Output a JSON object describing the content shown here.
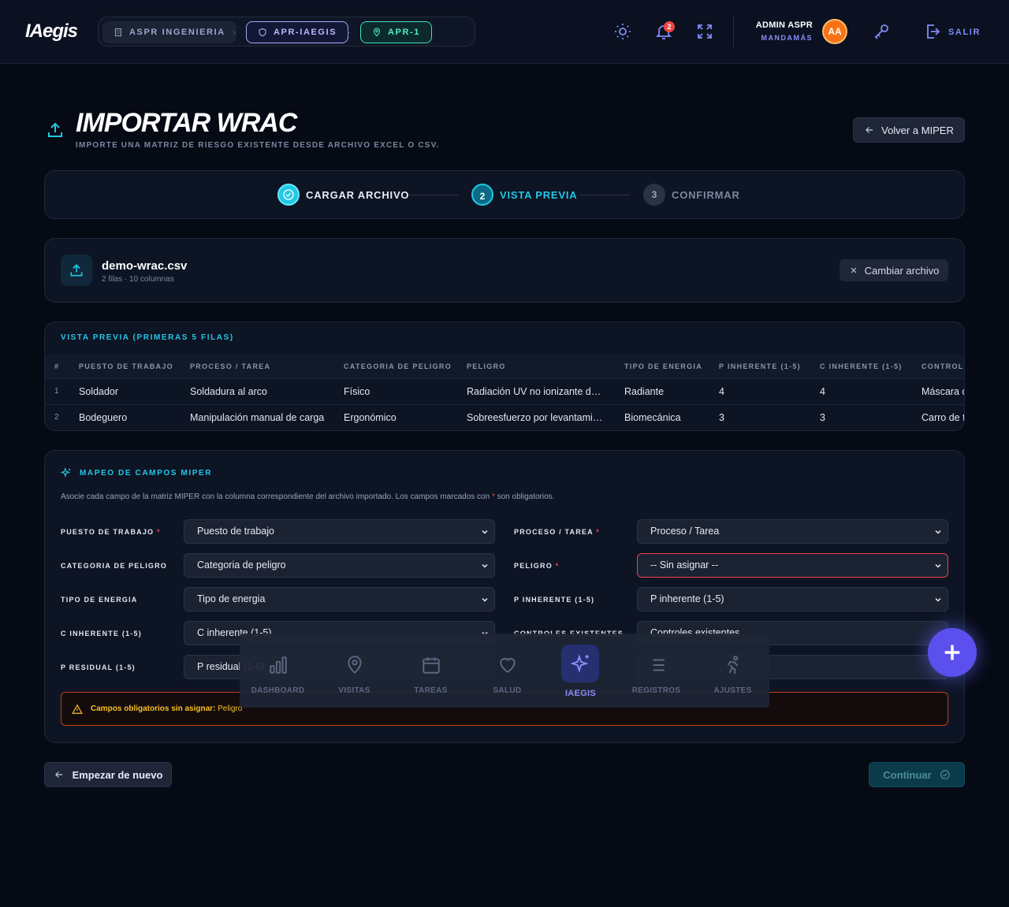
{
  "header": {
    "logo": "IAegis",
    "breadcrumbs": [
      "ASPR INGENIERIA",
      "APR-IAEGIS",
      "APR-1"
    ],
    "notification_count": "2",
    "user_name": "ADMIN ASPR",
    "user_role": "MANDAMÁS",
    "avatar_initials": "AA",
    "logout_label": "SALIR"
  },
  "page": {
    "title": "IMPORTAR WRAC",
    "subtitle": "IMPORTE UNA MATRIZ DE RIESGO EXISTENTE DESDE ARCHIVO EXCEL O CSV.",
    "back_label": "Volver a MIPER"
  },
  "stepper": {
    "steps": [
      {
        "number": "✓",
        "label": "CARGAR ARCHIVO",
        "state": "done"
      },
      {
        "number": "2",
        "label": "VISTA PREVIA",
        "state": "active"
      },
      {
        "number": "3",
        "label": "CONFIRMAR",
        "state": "pending"
      }
    ]
  },
  "file": {
    "name": "demo-wrac.csv",
    "meta": "2 filas · 10 columnas",
    "change_label": "Cambiar archivo"
  },
  "preview": {
    "title": "VISTA PREVIA (PRIMERAS 5 FILAS)",
    "columns": [
      "#",
      "PUESTO DE TRABAJO",
      "PROCESO / TAREA",
      "CATEGORIA DE PELIGRO",
      "PELIGRO",
      "TIPO DE ENERGIA",
      "P INHERENTE (1-5)",
      "C INHERENTE (1-5)",
      "CONTROLES EXISTENTES"
    ],
    "rows": [
      [
        "1",
        "Soldador",
        "Soldadura al arco",
        "Físico",
        "Radiación UV no ionizante de…",
        "Radiante",
        "4",
        "4",
        "Máscara de soldar"
      ],
      [
        "2",
        "Bodeguero",
        "Manipulación manual de carga",
        "Ergonómico",
        "Sobreesfuerzo por levantami…",
        "Biomecánica",
        "3",
        "3",
        "Carro de transporte"
      ]
    ]
  },
  "mapping": {
    "title": "MAPEO DE CAMPOS MIPER",
    "desc_before": "Asocie cada campo de la matriz MIPER con la columna correspondiente del archivo importado. Los campos marcados con ",
    "desc_star": "*",
    "desc_after": " son obligatorios.",
    "fields": [
      {
        "label": "PUESTO DE TRABAJO",
        "required": "*",
        "value": "Puesto de trabajo"
      },
      {
        "label": "PROCESO / TAREA",
        "required": "*",
        "value": "Proceso / Tarea"
      },
      {
        "label": "CATEGORIA DE PELIGRO",
        "required": "",
        "value": "Categoria de peligro"
      },
      {
        "label": "PELIGRO",
        "required": "*",
        "value": "-- Sin asignar --"
      },
      {
        "label": "TIPO DE ENERGIA",
        "required": "",
        "value": "Tipo de energia"
      },
      {
        "label": "P INHERENTE (1-5)",
        "required": "",
        "value": "P inherente (1-5)"
      },
      {
        "label": "C INHERENTE (1-5)",
        "required": "",
        "value": "C inherente (1-5)"
      },
      {
        "label": "CONTROLES EXISTENTES",
        "required": "",
        "value": "Controles existentes"
      },
      {
        "label": "P RESIDUAL (1-5)",
        "required": "",
        "value": "P residual (1-5)"
      },
      {
        "label": "",
        "required": "",
        "value": ""
      }
    ],
    "warning_label": "Campos obligatorios sin asignar:",
    "warning_value": "Peligro"
  },
  "actions": {
    "restart_label": "Empezar de nuevo",
    "continue_label": "Continuar"
  },
  "bottom_nav": {
    "items": [
      {
        "label": "DASHBOARD",
        "icon": "chart-bars-icon"
      },
      {
        "label": "VISITAS",
        "icon": "map-pin-icon"
      },
      {
        "label": "TAREAS",
        "icon": "calendar-icon"
      },
      {
        "label": "SALUD",
        "icon": "heart-icon"
      },
      {
        "label": "IAEGIS",
        "icon": "sparkles-icon",
        "active": true
      },
      {
        "label": "REGISTROS",
        "icon": "list-icon"
      },
      {
        "label": "AJUSTES",
        "icon": "person-running-icon"
      }
    ]
  },
  "colors": {
    "accent_cyan": "#22c7e6",
    "accent_indigo": "#818cf8",
    "error": "#ef4444",
    "warning": "#fbbf24"
  }
}
